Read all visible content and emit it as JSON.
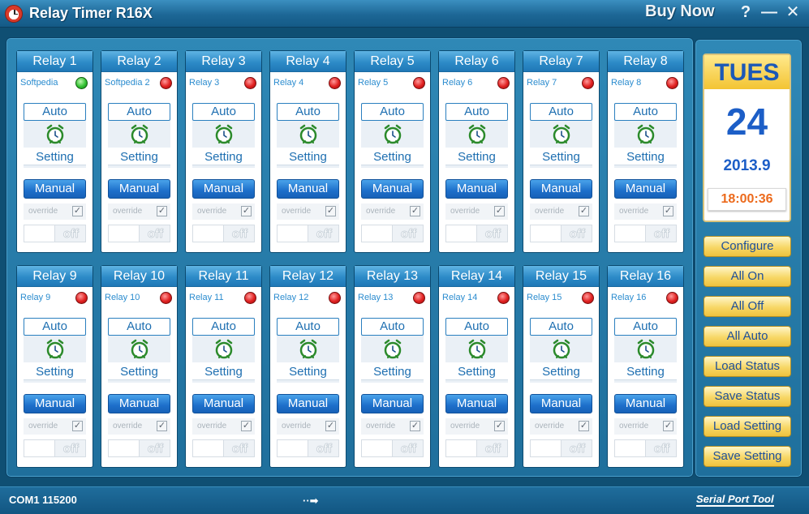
{
  "window": {
    "title": "Relay Timer R16X",
    "buy_now": "Buy Now",
    "help": "?",
    "minimize": "—",
    "close": "✕"
  },
  "relays": [
    {
      "header": "Relay 1",
      "name": "Softpedia",
      "status": "green"
    },
    {
      "header": "Relay 2",
      "name": "Softpedia 2",
      "status": "red"
    },
    {
      "header": "Relay 3",
      "name": "Relay 3",
      "status": "red"
    },
    {
      "header": "Relay 4",
      "name": "Relay 4",
      "status": "red"
    },
    {
      "header": "Relay 5",
      "name": "Relay 5",
      "status": "red"
    },
    {
      "header": "Relay 6",
      "name": "Relay 6",
      "status": "red"
    },
    {
      "header": "Relay 7",
      "name": "Relay 7",
      "status": "red"
    },
    {
      "header": "Relay 8",
      "name": "Relay 8",
      "status": "red"
    },
    {
      "header": "Relay 9",
      "name": "Relay 9",
      "status": "red"
    },
    {
      "header": "Relay 10",
      "name": "Relay 10",
      "status": "red"
    },
    {
      "header": "Relay 11",
      "name": "Relay 11",
      "status": "red"
    },
    {
      "header": "Relay 12",
      "name": "Relay 12",
      "status": "red"
    },
    {
      "header": "Relay 13",
      "name": "Relay 13",
      "status": "red"
    },
    {
      "header": "Relay 14",
      "name": "Relay 14",
      "status": "red"
    },
    {
      "header": "Relay 15",
      "name": "Relay 15",
      "status": "red"
    },
    {
      "header": "Relay 16",
      "name": "Relay 16",
      "status": "red"
    }
  ],
  "relay_controls": {
    "auto_label": "Auto",
    "setting_label": "Setting",
    "manual_label": "Manual",
    "override_label": "override",
    "override_checked": "✓",
    "toggle_label": "off"
  },
  "date": {
    "day": "TUES",
    "day_number": "24",
    "year_month": "2013.9",
    "time": "18:00:36"
  },
  "side_buttons": [
    "Configure",
    "All On",
    "All Off",
    "All Auto",
    "Load Status",
    "Save Status",
    "Load Setting",
    "Save Setting"
  ],
  "statusbar": {
    "port": "COM1 115200",
    "arrow": "··➡",
    "brand": "Serial Port Tool"
  },
  "colors": {
    "led_green": "#33c233",
    "led_red": "#e02020",
    "accent_blue": "#2d8bc8",
    "button_gold": "#f7d766",
    "time_orange": "#ec6a1c"
  }
}
